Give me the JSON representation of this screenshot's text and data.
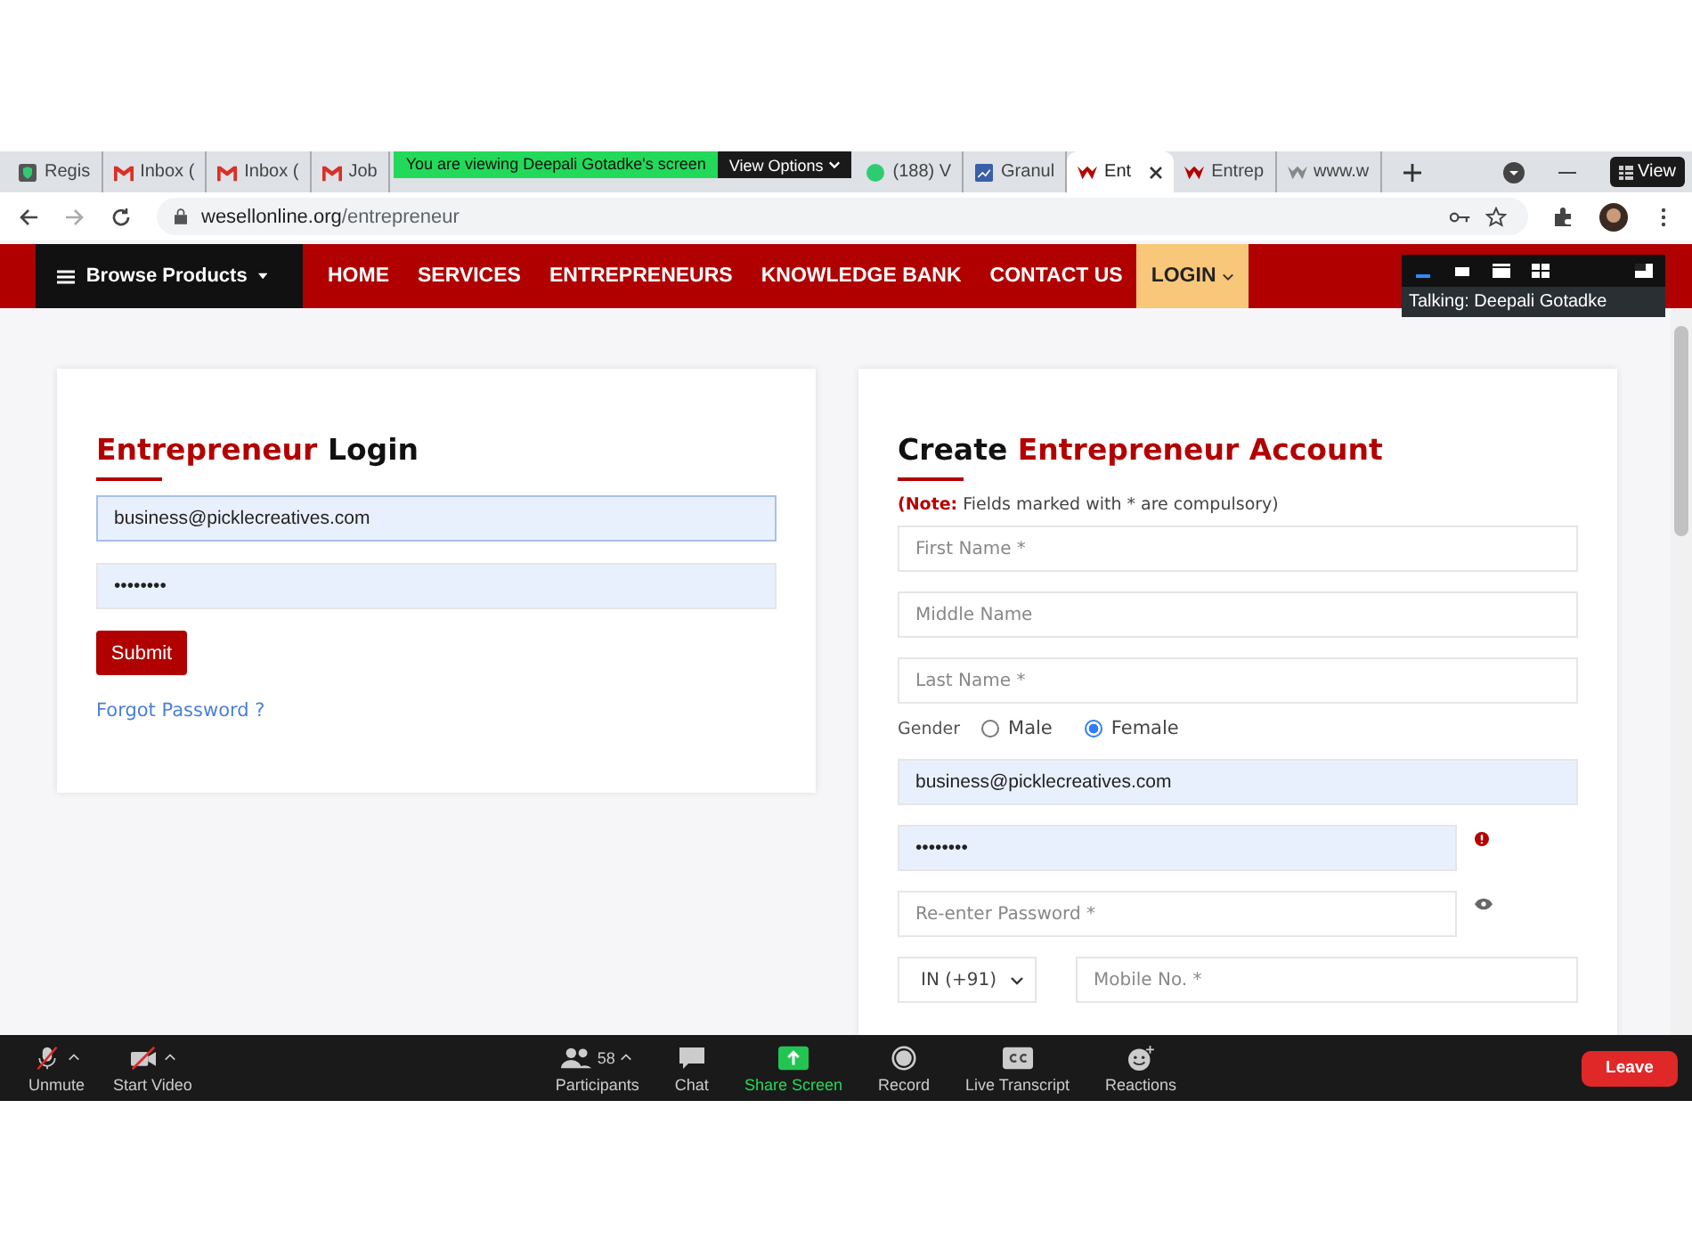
{
  "share_banner": {
    "text": "You are viewing Deepali Gotadke's screen",
    "button": "View Options"
  },
  "tabs_left": [
    {
      "label": "Regis",
      "kind": "shield",
      "selected": false
    },
    {
      "label": "Inbox (",
      "kind": "gmail",
      "selected": false
    },
    {
      "label": "Inbox (",
      "kind": "gmail",
      "selected": false
    },
    {
      "label": "Job",
      "kind": "gmail",
      "selected": false
    }
  ],
  "tabs_right": [
    {
      "label": "(188) V",
      "kind": "whatsapp",
      "selected": false
    },
    {
      "label": "Granul",
      "kind": "granule",
      "selected": false
    },
    {
      "label": "Ent",
      "kind": "wesell",
      "selected": true
    },
    {
      "label": "Entrep",
      "kind": "wesell",
      "selected": false
    },
    {
      "label": "www.w",
      "kind": "wesell-grey",
      "selected": false
    }
  ],
  "view_button": "View",
  "address": {
    "host": "wesellonline.org",
    "path": "/entrepreneur"
  },
  "nav": {
    "browse": "Browse Products",
    "items": [
      {
        "label": "HOME",
        "selected": false
      },
      {
        "label": "SERVICES",
        "selected": false
      },
      {
        "label": "ENTREPRENEURS",
        "selected": false
      },
      {
        "label": "KNOWLEDGE BANK",
        "selected": false
      },
      {
        "label": "CONTACT US",
        "selected": false
      },
      {
        "label": "LOGIN",
        "selected": true
      }
    ]
  },
  "talking": "Talking: Deepali Gotadke",
  "login": {
    "title_accent": "Entrepreneur",
    "title_rest": "Login",
    "email": "business@picklecreatives.com",
    "password": "••••••••",
    "submit": "Submit",
    "forgot": "Forgot Password ?"
  },
  "register": {
    "title_rest": "Create",
    "title_accent": "Entrepreneur Account",
    "note_label": "(Note:",
    "note_text": "Fields marked with * are compulsory)",
    "name_fields": [
      {
        "placeholder": "First Name *"
      },
      {
        "placeholder": "Middle Name"
      },
      {
        "placeholder": "Last Name *"
      }
    ],
    "gender_label": "Gender",
    "genders": [
      {
        "label": "Male",
        "selected": false
      },
      {
        "label": "Female",
        "selected": true
      }
    ],
    "email": "business@picklecreatives.com",
    "password": "••••••••",
    "reenter_placeholder": "Re-enter Password *",
    "country": "IN (+91)",
    "mobile_placeholder": "Mobile No. *"
  },
  "toolbar": {
    "left": [
      {
        "label": "Unmute",
        "kind": "mic"
      },
      {
        "label": "Start Video",
        "kind": "video"
      }
    ],
    "center": [
      {
        "label": "Participants",
        "kind": "participants",
        "count": "58"
      },
      {
        "label": "Chat",
        "kind": "chat"
      },
      {
        "label": "Share Screen",
        "kind": "share"
      },
      {
        "label": "Record",
        "kind": "record"
      },
      {
        "label": "Live Transcript",
        "kind": "cc"
      },
      {
        "label": "Reactions",
        "kind": "reactions"
      }
    ],
    "leave": "Leave"
  }
}
